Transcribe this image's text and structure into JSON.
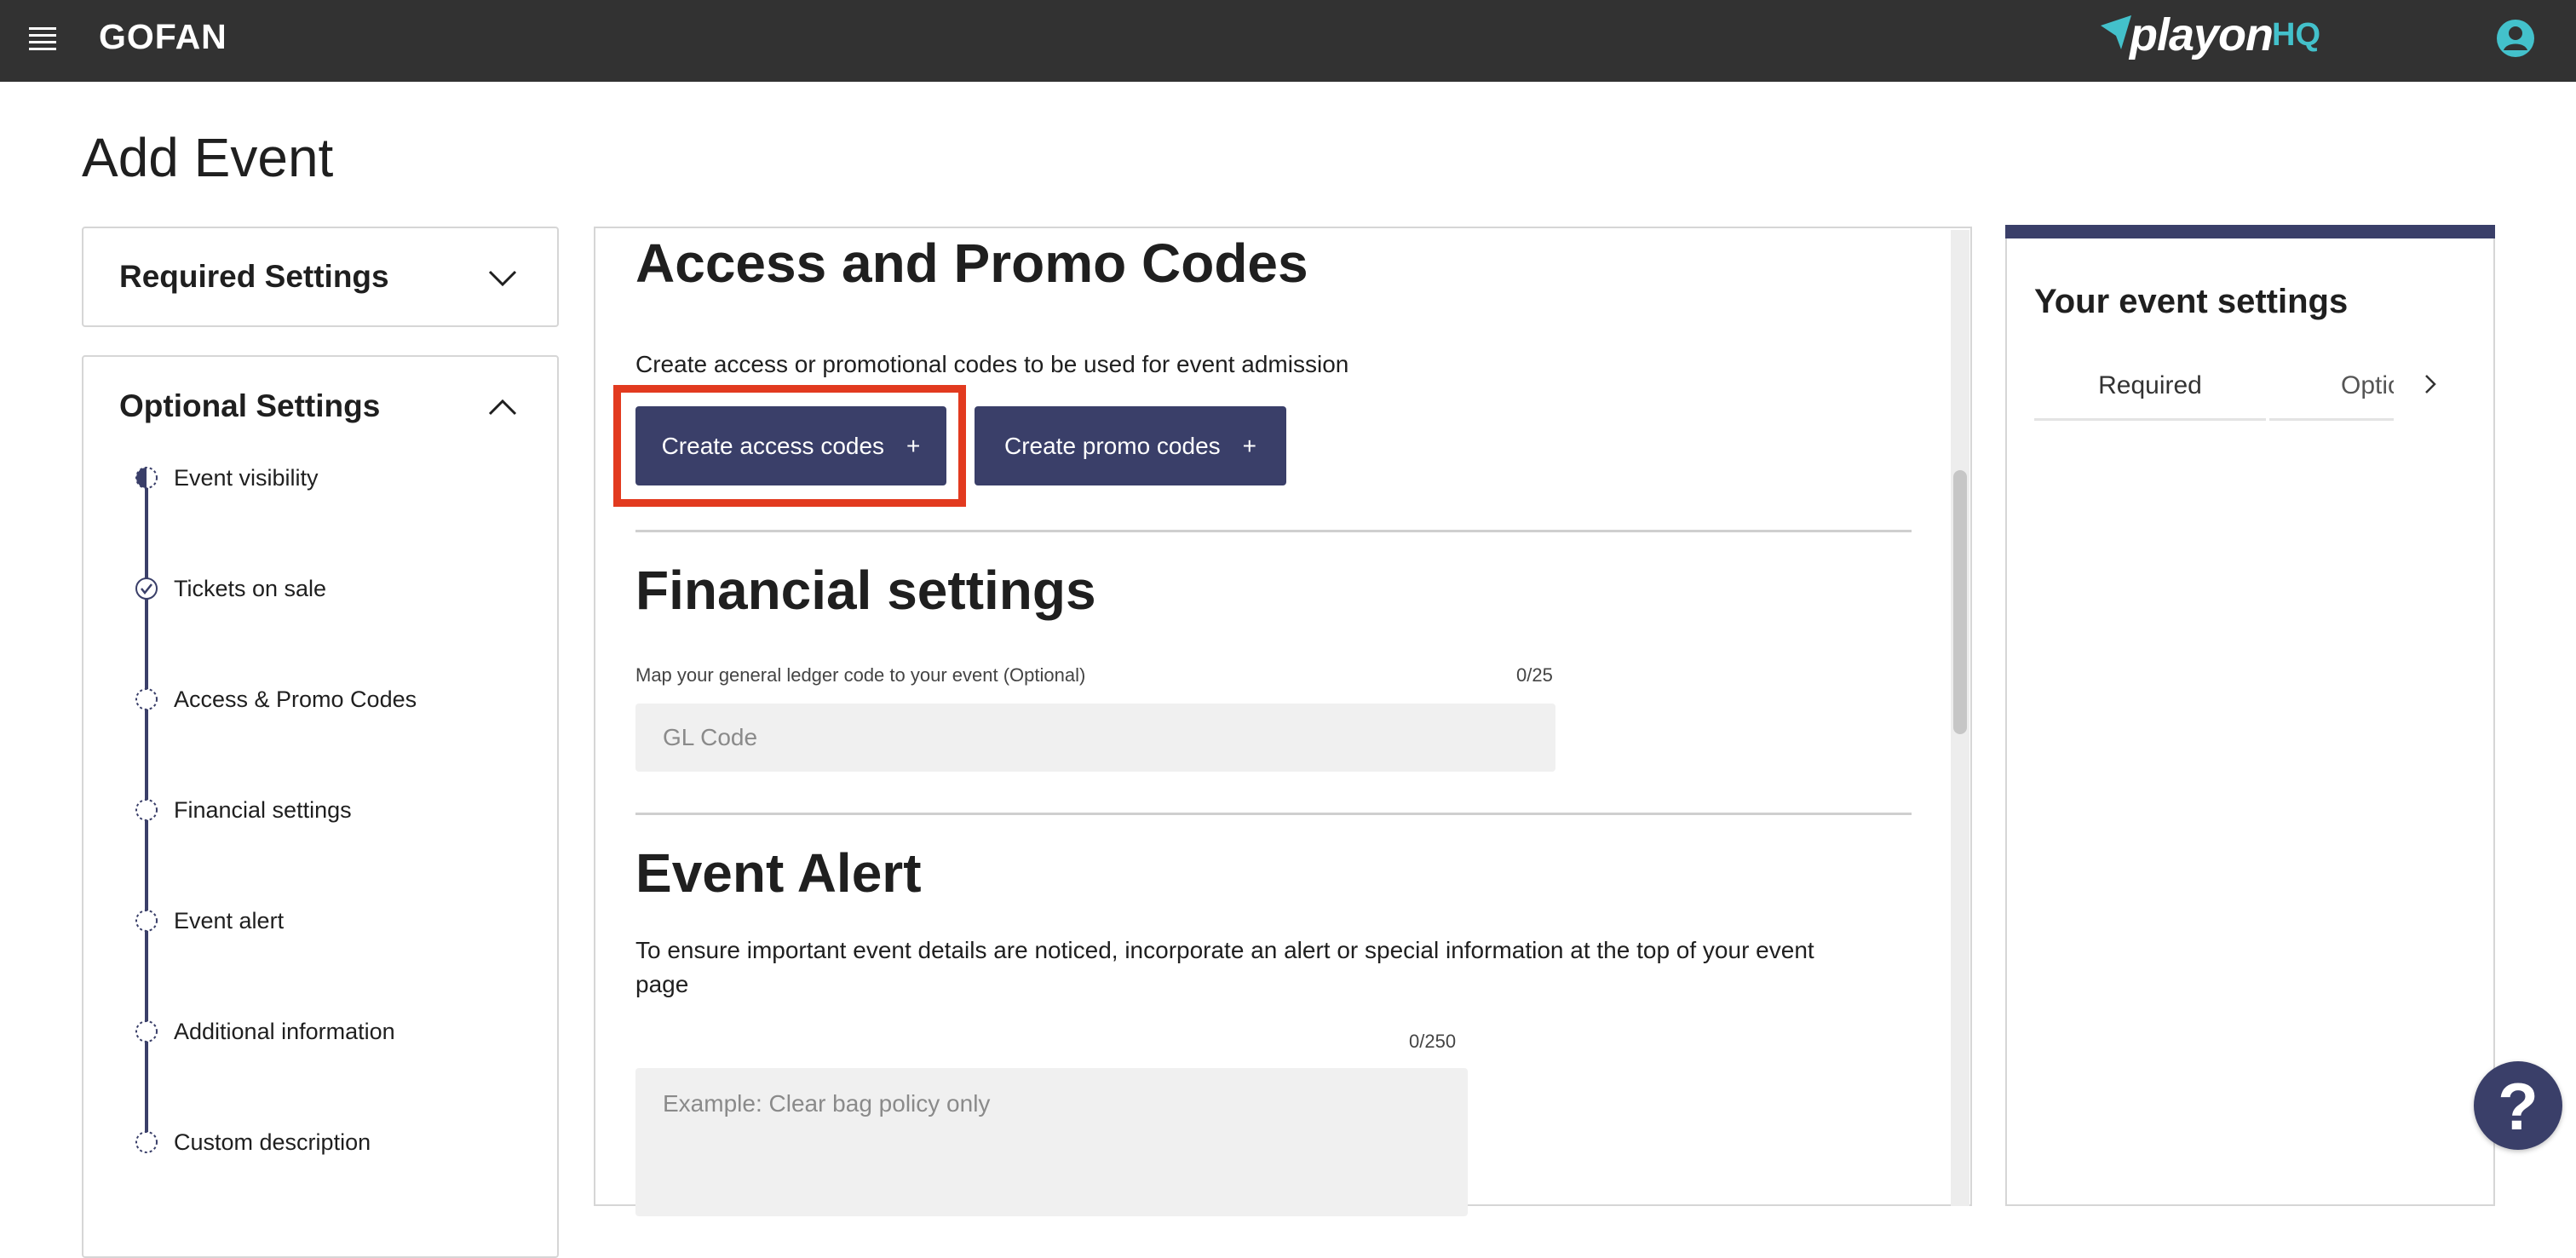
{
  "header": {
    "brand": "GOFAN",
    "logo_text": "playon",
    "logo_suffix": "HQ",
    "icons": {
      "menu": "hamburger-menu-icon",
      "user": "user-avatar-icon"
    },
    "accent_color": "#43c1cb"
  },
  "page": {
    "title": "Add Event"
  },
  "sidebar": {
    "required": {
      "title": "Required Settings",
      "expanded": false
    },
    "optional": {
      "title": "Optional Settings",
      "expanded": true,
      "steps": [
        {
          "label": "Event visibility",
          "status": "in-progress"
        },
        {
          "label": "Tickets on sale",
          "status": "complete"
        },
        {
          "label": "Access & Promo Codes",
          "status": "pending"
        },
        {
          "label": "Financial settings",
          "status": "pending"
        },
        {
          "label": "Event alert",
          "status": "pending"
        },
        {
          "label": "Additional information",
          "status": "pending"
        },
        {
          "label": "Custom description",
          "status": "pending"
        }
      ]
    }
  },
  "main": {
    "access": {
      "title": "Access and Promo Codes",
      "description": "Create access or promotional codes to be used for event admission",
      "create_access_label": "Create access codes",
      "create_promo_label": "Create promo codes",
      "button_glyph": "+"
    },
    "financial": {
      "title": "Financial settings",
      "gl_label": "Map your general ledger code to your event (Optional)",
      "gl_counter": "0/25",
      "gl_placeholder": "GL Code"
    },
    "alert": {
      "title": "Event Alert",
      "description_line1": "To ensure important event details are noticed, incorporate an alert or special information at the top of your event",
      "description_line2": "page",
      "counter": "0/250",
      "placeholder": "Example: Clear bag policy only"
    }
  },
  "summary": {
    "title": "Your event settings",
    "tabs": [
      "Required",
      "Optional"
    ]
  },
  "help": {
    "glyph": "?"
  },
  "colors": {
    "primary": "#3a3f69",
    "highlight": "#e23a1f",
    "topbar": "#323232"
  }
}
